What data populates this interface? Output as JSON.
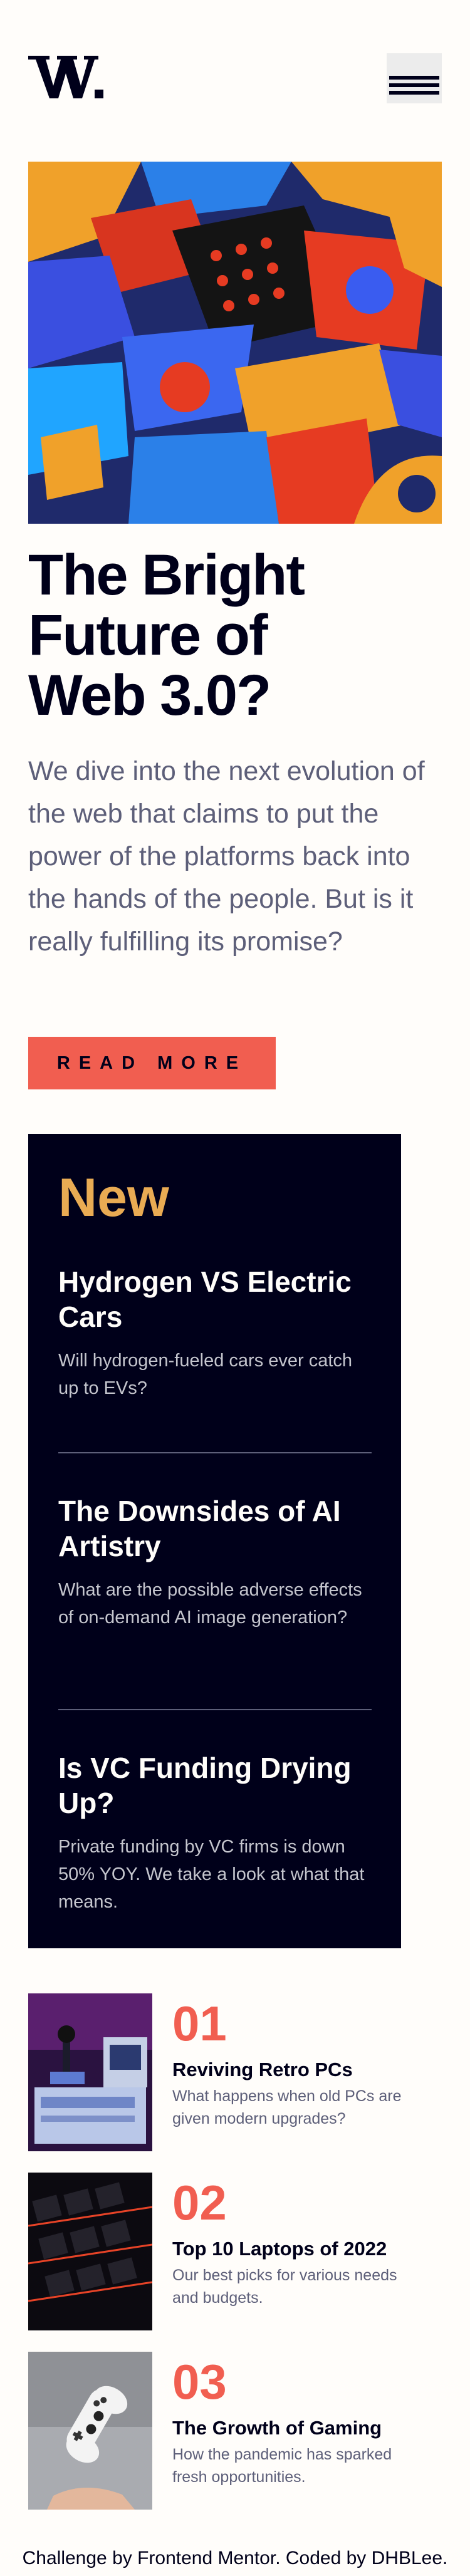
{
  "header": {
    "logo_text": "W.",
    "menu_icon": "hamburger-menu-icon"
  },
  "hero": {
    "image_icon": "abstract-3d-blocks-image",
    "title": "The Bright\nFuture of\nWeb 3.0?",
    "description": "We dive into the next evolution of the web that claims to put the power of the platforms back into the hands of the people. But is it really fulfilling its promise?",
    "button_label": "READ MORE"
  },
  "new_section": {
    "heading": "New",
    "items": [
      {
        "title": "Hydrogen VS Electric Cars",
        "description": "Will hydrogen-fueled cars ever catch up to EVs?"
      },
      {
        "title": "The Downsides of AI Artistry",
        "description": "What are the possible adverse effects of on-demand AI image generation?"
      },
      {
        "title": "Is VC Funding Drying Up?",
        "description": "Private funding by VC firms is down 50% YOY. We take a look at what that means."
      }
    ]
  },
  "articles": [
    {
      "number": "01",
      "title": "Reviving Retro PCs",
      "description": "What happens when old PCs are given modern upgrades?",
      "image_icon": "retro-pc-image"
    },
    {
      "number": "02",
      "title": "Top 10 Laptops of 2022",
      "description": "Our best picks for various needs and budgets.",
      "image_icon": "laptop-keyboard-image"
    },
    {
      "number": "03",
      "title": "The Growth of Gaming",
      "description": "How the pandemic has sparked fresh opportunities.",
      "image_icon": "game-controller-image"
    }
  ],
  "footer": {
    "text": "Challenge by Frontend Mentor. Coded by DHBLee."
  },
  "colors": {
    "accent_red": "#f15e50",
    "accent_orange": "#e9ab53",
    "dark_navy": "#00001a",
    "grayish_blue": "#5d5f79",
    "off_white": "#fffdfa"
  }
}
